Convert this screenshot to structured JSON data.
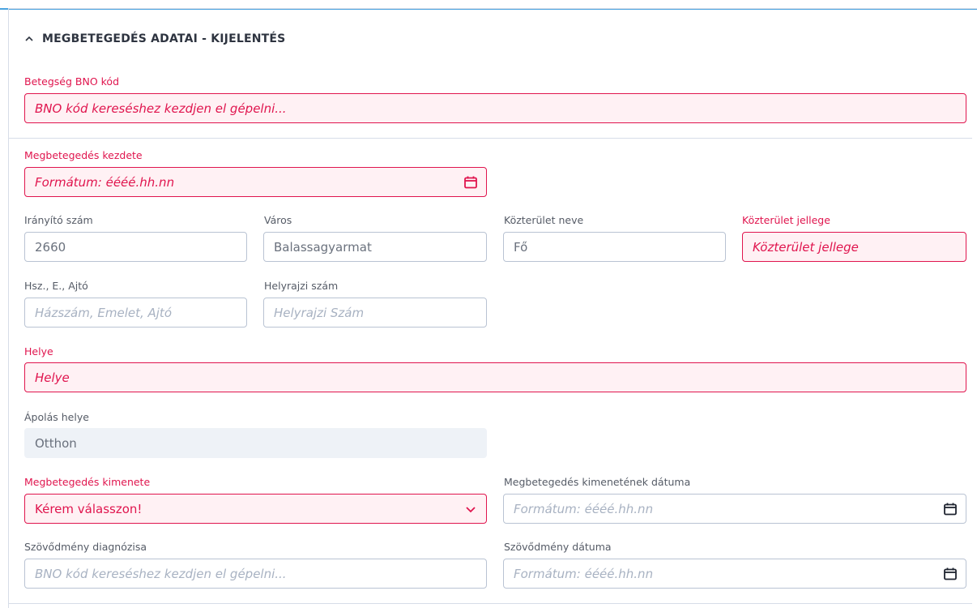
{
  "section": {
    "title": "MEGBETEGEDÉS ADATAI - KIJELENTÉS"
  },
  "bno": {
    "label": "Betegség BNO kód",
    "placeholder": "BNO kód kereséshez kezdjen el gépelni..."
  },
  "onset": {
    "label": "Megbetegedés kezdete",
    "placeholder": "Formátum: éééé.hh.nn"
  },
  "address": {
    "zip": {
      "label": "Irányító szám",
      "value": "2660"
    },
    "city": {
      "label": "Város",
      "value": "Balassagyarmat"
    },
    "street_name": {
      "label": "Közterület neve",
      "value": "Fő"
    },
    "street_type": {
      "label": "Közterület jellege",
      "placeholder": "Közterület jellege"
    },
    "house": {
      "label": "Hsz., E., Ajtó",
      "placeholder": "Házszám, Emelet, Ajtó"
    },
    "parcel": {
      "label": "Helyrajzi szám",
      "placeholder": "Helyrajzi Szám"
    }
  },
  "place": {
    "label": "Helye",
    "placeholder": "Helye"
  },
  "care_place": {
    "label": "Ápolás helye",
    "value": "Otthon"
  },
  "outcome": {
    "label": "Megbetegedés kimenete",
    "value": "Kérem válasszon!"
  },
  "outcome_date": {
    "label": "Megbetegedés kimenetének dátuma",
    "placeholder": "Formátum: éééé.hh.nn"
  },
  "complication": {
    "label": "Szövődmény diagnózisa",
    "placeholder": "BNO kód kereséshez kezdjen el gépelni..."
  },
  "complication_date": {
    "label": "Szövődmény dátuma",
    "placeholder": "Formátum: éééé.hh.nn"
  },
  "colors": {
    "required": "#e0154e",
    "required_bg": "#fff1f4",
    "border": "#b9c3d3",
    "accent": "#4aa3df"
  }
}
